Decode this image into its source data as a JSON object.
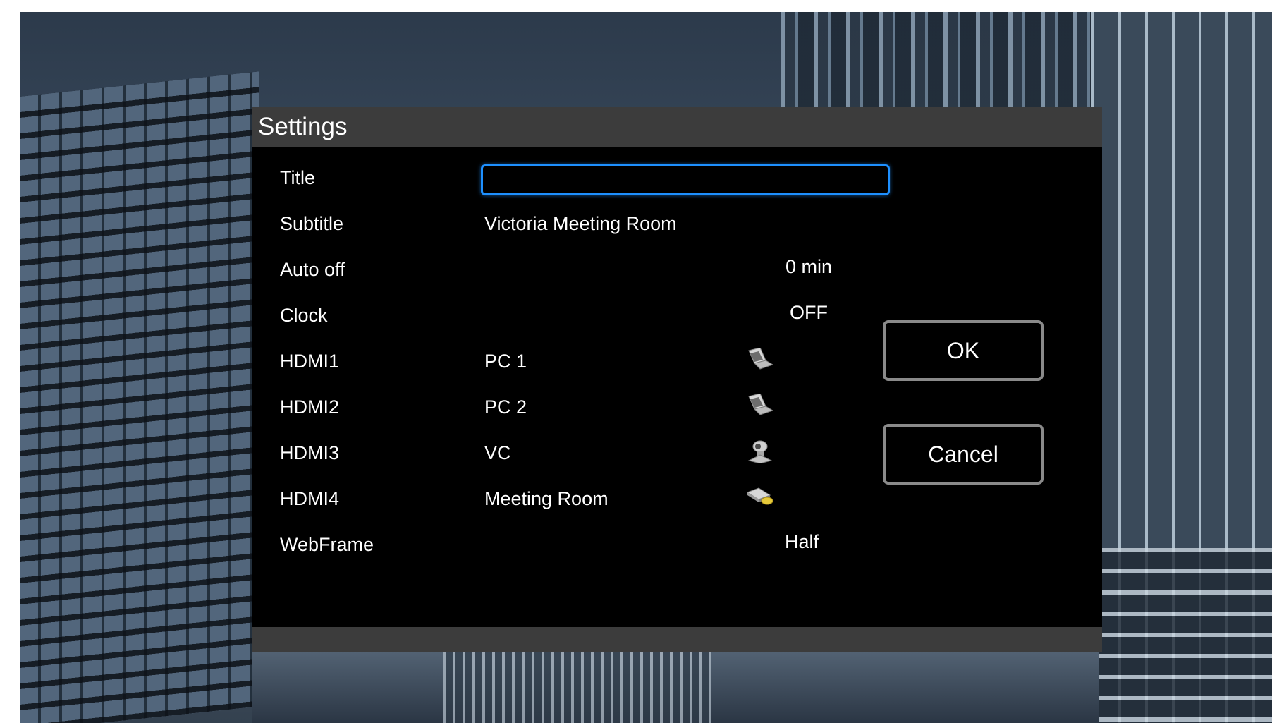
{
  "dialog": {
    "title": "Settings",
    "ok_label": "OK",
    "cancel_label": "Cancel"
  },
  "fields": {
    "title": {
      "label": "Title",
      "value": ""
    },
    "subtitle": {
      "label": "Subtitle",
      "value": "Victoria Meeting Room"
    },
    "auto_off": {
      "label": "Auto off",
      "value": "0 min"
    },
    "clock": {
      "label": "Clock",
      "value": "OFF"
    },
    "hdmi1": {
      "label": "HDMI1",
      "name": "PC 1",
      "icon": "laptop-icon"
    },
    "hdmi2": {
      "label": "HDMI2",
      "name": "PC 2",
      "icon": "laptop-icon"
    },
    "hdmi3": {
      "label": "HDMI3",
      "name": "VC",
      "icon": "video-camera-icon"
    },
    "hdmi4": {
      "label": "HDMI4",
      "name": "Meeting Room",
      "icon": "document-camera-icon"
    },
    "webframe": {
      "label": "WebFrame",
      "value": "Half"
    }
  },
  "colors": {
    "dialog_bg": "#000000",
    "header_bg": "#3c3c3c",
    "focus_border": "#1e90ff",
    "button_border": "#8a8a8a",
    "text": "#ffffff"
  }
}
